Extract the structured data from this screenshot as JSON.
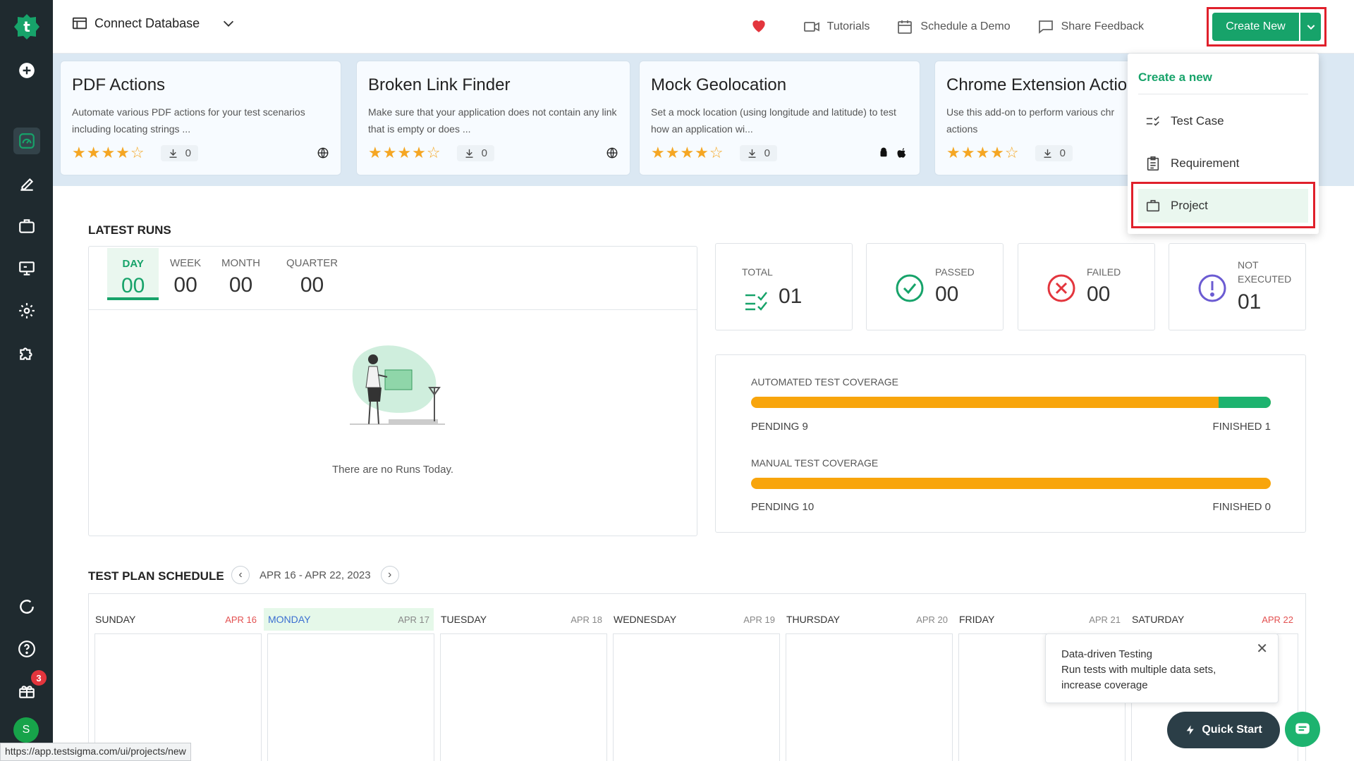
{
  "topbar": {
    "db_label": "Connect Database",
    "tutorials": "Tutorials",
    "schedule_demo": "Schedule a Demo",
    "share_feedback": "Share Feedback",
    "create_new": "Create New"
  },
  "addons": [
    {
      "title": "PDF Actions",
      "desc": "Automate various PDF actions for your test scenarios including locating strings ...",
      "stars": "★★★★☆",
      "downloads": "0"
    },
    {
      "title": "Broken Link Finder",
      "desc": "Make sure that your application does not contain any link that is empty or does ...",
      "stars": "★★★★☆",
      "downloads": "0"
    },
    {
      "title": "Mock Geolocation",
      "desc": "Set a mock location (using longitude and latitude) to test how an application wi...",
      "stars": "★★★★☆",
      "downloads": "0"
    },
    {
      "title": "Chrome Extension Actio",
      "desc": "Use this add-on to perform various chr actions",
      "stars": "★★★★☆",
      "downloads": "0"
    }
  ],
  "latest_runs": {
    "title": "LATEST RUNS",
    "tabs": [
      {
        "label": "DAY",
        "value": "00"
      },
      {
        "label": "WEEK",
        "value": "00"
      },
      {
        "label": "MONTH",
        "value": "00"
      },
      {
        "label": "QUARTER",
        "value": "00"
      }
    ],
    "empty_text": "There are no Runs Today."
  },
  "stats": {
    "total": {
      "label": "TOTAL",
      "value": "01"
    },
    "passed": {
      "label": "PASSED",
      "value": "00"
    },
    "failed": {
      "label": "FAILED",
      "value": "00"
    },
    "not_executed": {
      "label1": "NOT",
      "label2": "EXECUTED",
      "value": "01"
    }
  },
  "coverage": {
    "automated": {
      "label": "AUTOMATED TEST COVERAGE",
      "pending": "PENDING 9",
      "finished": "FINISHED 1",
      "finished_fraction": 0.1
    },
    "manual": {
      "label": "MANUAL TEST COVERAGE",
      "pending": "PENDING 10",
      "finished": "FINISHED 0",
      "finished_fraction": 0
    }
  },
  "schedule": {
    "title": "TEST PLAN SCHEDULE",
    "range": "APR 16 - APR 22, 2023",
    "days": [
      {
        "name": "SUNDAY",
        "date": "APR 16"
      },
      {
        "name": "MONDAY",
        "date": "APR 17"
      },
      {
        "name": "TUESDAY",
        "date": "APR 18"
      },
      {
        "name": "WEDNESDAY",
        "date": "APR 19"
      },
      {
        "name": "THURSDAY",
        "date": "APR 20"
      },
      {
        "name": "FRIDAY",
        "date": "APR 21"
      },
      {
        "name": "SATURDAY",
        "date": "APR 22"
      }
    ]
  },
  "menu": {
    "heading": "Create a new",
    "items": [
      "Test Case",
      "Requirement",
      "Project"
    ]
  },
  "tooltip": {
    "line1": "Data-driven Testing",
    "line2": "Run tests with multiple data sets,",
    "line3": "increase coverage"
  },
  "quick_start": "Quick Start",
  "gift_badge": "3",
  "avatar_letter": "S",
  "status_url": "https://app.testsigma.com/ui/projects/new",
  "colors": {
    "brand_green": "#17a36a",
    "sidebar": "#1f2a2f",
    "highlight_red": "#e0202b",
    "pending_orange": "#f8a50c"
  }
}
